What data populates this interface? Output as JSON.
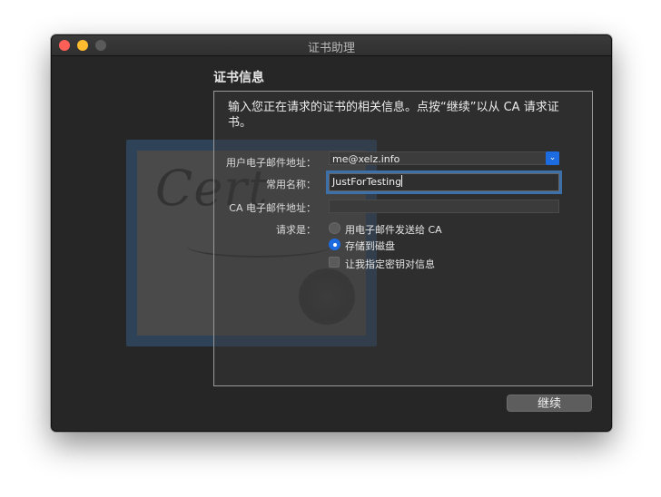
{
  "window": {
    "title": "证书助理"
  },
  "section": {
    "title": "证书信息"
  },
  "intro_text": "输入您正在请求的证书的相关信息。点按“继续”以从 CA 请求证书。",
  "form": {
    "user_email_label": "用户电子邮件地址：",
    "user_email_value": "me@xelz.info",
    "common_name_label": "常用名称：",
    "common_name_value": "JustForTesting",
    "ca_email_label": "CA 电子邮件地址：",
    "ca_email_value": "",
    "request_label": "请求是：",
    "option_email_ca": "用电子邮件发送给 CA",
    "option_save_disk": "存储到磁盘",
    "option_specify_key": "让我指定密钥对信息"
  },
  "buttons": {
    "continue": "继续"
  },
  "colors": {
    "accent": "#1c6be0",
    "close": "#fe5f57",
    "minimize": "#febc2e"
  }
}
